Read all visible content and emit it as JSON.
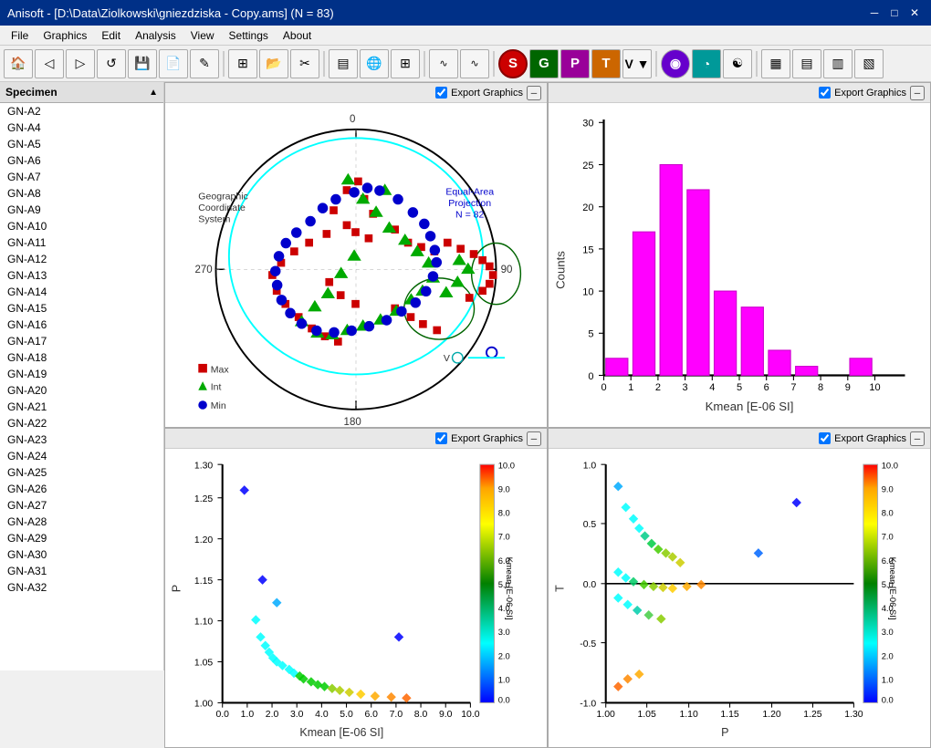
{
  "titlebar": {
    "title": "Anisoft - [D:\\Data\\Ziolkowski\\gniezdziska - Copy.ams]    (N = 83)",
    "n_count": "N = 83"
  },
  "menubar": {
    "items": [
      "File",
      "Graphics",
      "Edit",
      "Analysis",
      "View",
      "Settings",
      "About"
    ]
  },
  "sidebar": {
    "header": "Specimen",
    "items": [
      "GN-A2",
      "GN-A4",
      "GN-A5",
      "GN-A6",
      "GN-A7",
      "GN-A8",
      "GN-A9",
      "GN-A10",
      "GN-A11",
      "GN-A12",
      "GN-A13",
      "GN-A14",
      "GN-A15",
      "GN-A16",
      "GN-A17",
      "GN-A18",
      "GN-A19",
      "GN-A20",
      "GN-A21",
      "GN-A22",
      "GN-A23",
      "GN-A24",
      "GN-A25",
      "GN-A26",
      "GN-A27",
      "GN-A28",
      "GN-A29",
      "GN-A30",
      "GN-A31",
      "GN-A32"
    ]
  },
  "panels": {
    "stereonet": {
      "export_label": "Export Graphics",
      "geo_coord": "Geographic\nCoordinate\nSystem",
      "equal_area": "Equal-Area\nProjection\nN = 82",
      "labels": {
        "north": "0",
        "south": "180",
        "east": "90",
        "west": "270"
      },
      "legend": {
        "max_label": "Max",
        "int_label": "Int",
        "min_label": "Min"
      }
    },
    "histogram": {
      "export_label": "Export Graphics",
      "xlabel": "Kmean [E-06 SI]",
      "ylabel": "Counts",
      "bars": [
        2,
        17,
        25,
        22,
        10,
        8,
        3,
        1,
        0,
        2
      ],
      "yticks": [
        "0",
        "5",
        "10",
        "15",
        "20",
        "25",
        "30"
      ],
      "xticks": [
        "0",
        "1",
        "2",
        "3",
        "4",
        "5",
        "6",
        "7",
        "8",
        "9",
        "10"
      ],
      "max_y": 30
    },
    "scatter1": {
      "export_label": "Export Graphics",
      "xlabel": "Kmean [E-06 SI]",
      "ylabel": "P",
      "colorbar_label": "Kmean [E-06 SI]",
      "colorbar_ticks": [
        "10.0",
        "9.0",
        "8.0",
        "7.0",
        "6.0",
        "5.0",
        "4.0",
        "3.0",
        "2.0",
        "1.0",
        "0.0"
      ],
      "yticks": [
        "1.00",
        "1.05",
        "1.10",
        "1.15",
        "1.20",
        "1.25",
        "1.30"
      ],
      "xticks": [
        "0.0",
        "1.0",
        "2.0",
        "3.0",
        "4.0",
        "5.0",
        "6.0",
        "7.0",
        "8.0",
        "9.0",
        "10.0"
      ]
    },
    "scatter2": {
      "export_label": "Export Graphics",
      "xlabel": "P",
      "ylabel": "T",
      "colorbar_label": "Kmean [E-06 SI]",
      "colorbar_ticks": [
        "10.0",
        "9.0",
        "8.0",
        "7.0",
        "6.0",
        "5.0",
        "4.0",
        "3.0",
        "2.0",
        "1.0",
        "0.0"
      ],
      "yticks": [
        "-1.0",
        "-0.5",
        "0.0",
        "0.5",
        "1.0"
      ],
      "xticks": [
        "1.00",
        "1.05",
        "1.10",
        "1.15",
        "1.20",
        "1.25",
        "1.30"
      ]
    }
  },
  "toolbar": {
    "buttons": [
      {
        "name": "back",
        "icon": "◁",
        "tooltip": "Back"
      },
      {
        "name": "forward",
        "icon": "▷",
        "tooltip": "Forward"
      },
      {
        "name": "refresh",
        "icon": "↺",
        "tooltip": "Refresh"
      },
      {
        "name": "save",
        "icon": "💾",
        "tooltip": "Save"
      },
      {
        "name": "save-as",
        "icon": "📄",
        "tooltip": "Save As"
      },
      {
        "name": "edit",
        "icon": "✎",
        "tooltip": "Edit"
      },
      {
        "name": "table",
        "icon": "⊞",
        "tooltip": "Table"
      },
      {
        "name": "open",
        "icon": "📂",
        "tooltip": "Open"
      },
      {
        "name": "scissors",
        "icon": "✂",
        "tooltip": "Cut"
      },
      {
        "name": "calc",
        "icon": "≡",
        "tooltip": "Calculator"
      },
      {
        "name": "globe",
        "icon": "🌐",
        "tooltip": "Globe"
      },
      {
        "name": "grid",
        "icon": "▦",
        "tooltip": "Grid"
      },
      {
        "name": "wave1",
        "icon": "∿",
        "tooltip": "Wave1"
      },
      {
        "name": "wave2",
        "icon": "∿",
        "tooltip": "Wave2"
      },
      {
        "name": "S-btn",
        "icon": "S",
        "tooltip": "S"
      },
      {
        "name": "G-btn",
        "icon": "G",
        "tooltip": "G"
      },
      {
        "name": "P-btn",
        "icon": "P",
        "tooltip": "P"
      },
      {
        "name": "T-btn",
        "icon": "T",
        "tooltip": "T"
      },
      {
        "name": "V-btn",
        "icon": "V",
        "tooltip": "V"
      },
      {
        "name": "purple-btn",
        "icon": "◉",
        "tooltip": "Purple"
      },
      {
        "name": "teal-btn",
        "icon": "◔",
        "tooltip": "Teal"
      },
      {
        "name": "yin-yang",
        "icon": "☯",
        "tooltip": "YinYang"
      },
      {
        "name": "bars1",
        "icon": "▦",
        "tooltip": "Bars1"
      },
      {
        "name": "bars2",
        "icon": "▤",
        "tooltip": "Bars2"
      },
      {
        "name": "bars3",
        "icon": "▥",
        "tooltip": "Bars3"
      },
      {
        "name": "bars4",
        "icon": "▧",
        "tooltip": "Bars4"
      }
    ]
  }
}
